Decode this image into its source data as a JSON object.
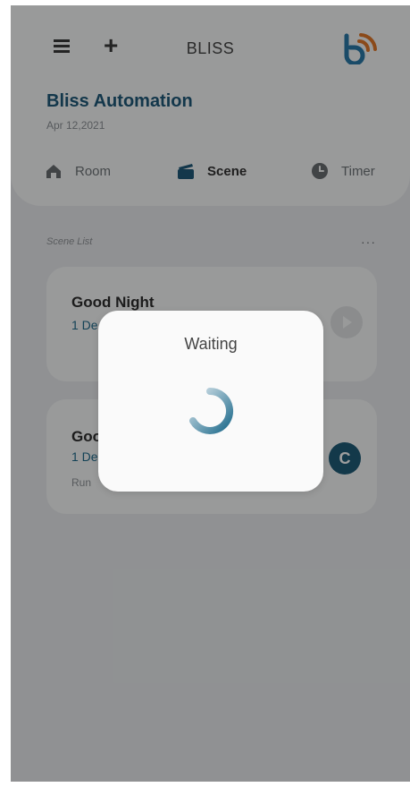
{
  "header": {
    "app_title": "BLISS",
    "brand_name": "Bliss Automation",
    "date": "Apr 12,2021"
  },
  "tabs": [
    {
      "label": "Room",
      "icon": "home-icon",
      "active": false
    },
    {
      "label": "Scene",
      "icon": "scene-icon",
      "active": true
    },
    {
      "label": "Timer",
      "icon": "clock-icon",
      "active": false
    }
  ],
  "scene_list": {
    "label": "Scene List",
    "more": "···",
    "scenes": [
      {
        "name": "Good Night",
        "devices": "1 De",
        "run": ""
      },
      {
        "name": "Goo",
        "devices": "1 De",
        "run": "Run",
        "run_icon_glyph": "C"
      }
    ]
  },
  "dialog": {
    "title": "Waiting"
  },
  "colors": {
    "accent": "#1f5a7a",
    "logo_blue": "#2a7aa8",
    "logo_orange": "#e0782a",
    "overlay": "rgba(0,0,0,0.38)"
  }
}
